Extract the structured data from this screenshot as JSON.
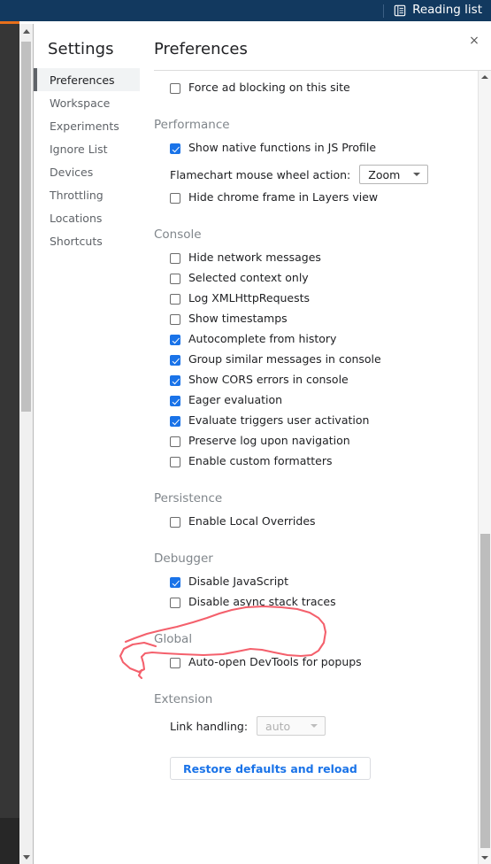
{
  "browser": {
    "reading_list_label": "Reading list",
    "reading_list_icon": "reading-list-icon",
    "topbar_color": "#12395f"
  },
  "dialog": {
    "close_label": "×",
    "sidebar_title": "Settings",
    "content_title": "Preferences"
  },
  "sidebar": {
    "items": [
      {
        "label": "Preferences",
        "selected": true
      },
      {
        "label": "Workspace",
        "selected": false
      },
      {
        "label": "Experiments",
        "selected": false
      },
      {
        "label": "Ignore List",
        "selected": false
      },
      {
        "label": "Devices",
        "selected": false
      },
      {
        "label": "Throttling",
        "selected": false
      },
      {
        "label": "Locations",
        "selected": false
      },
      {
        "label": "Shortcuts",
        "selected": false
      }
    ]
  },
  "preferences": {
    "orphan_setting": {
      "label": "Force ad blocking on this site",
      "checked": false
    },
    "sections": [
      {
        "title": "Performance",
        "rows": [
          {
            "kind": "checkbox",
            "label": "Show native functions in JS Profile",
            "checked": true
          },
          {
            "kind": "select",
            "label": "Flamechart mouse wheel action:",
            "value": "Zoom",
            "disabled": false
          },
          {
            "kind": "checkbox",
            "label": "Hide chrome frame in Layers view",
            "checked": false
          }
        ]
      },
      {
        "title": "Console",
        "rows": [
          {
            "kind": "checkbox",
            "label": "Hide network messages",
            "checked": false
          },
          {
            "kind": "checkbox",
            "label": "Selected context only",
            "checked": false
          },
          {
            "kind": "checkbox",
            "label": "Log XMLHttpRequests",
            "checked": false
          },
          {
            "kind": "checkbox",
            "label": "Show timestamps",
            "checked": false
          },
          {
            "kind": "checkbox",
            "label": "Autocomplete from history",
            "checked": true
          },
          {
            "kind": "checkbox",
            "label": "Group similar messages in console",
            "checked": true
          },
          {
            "kind": "checkbox",
            "label": "Show CORS errors in console",
            "checked": true
          },
          {
            "kind": "checkbox",
            "label": "Eager evaluation",
            "checked": true
          },
          {
            "kind": "checkbox",
            "label": "Evaluate triggers user activation",
            "checked": true
          },
          {
            "kind": "checkbox",
            "label": "Preserve log upon navigation",
            "checked": false
          },
          {
            "kind": "checkbox",
            "label": "Enable custom formatters",
            "checked": false
          }
        ]
      },
      {
        "title": "Persistence",
        "rows": [
          {
            "kind": "checkbox",
            "label": "Enable Local Overrides",
            "checked": false
          }
        ]
      },
      {
        "title": "Debugger",
        "rows": [
          {
            "kind": "checkbox",
            "label": "Disable JavaScript",
            "checked": true
          },
          {
            "kind": "checkbox",
            "label": "Disable async stack traces",
            "checked": false
          }
        ]
      },
      {
        "title": "Global",
        "rows": [
          {
            "kind": "checkbox",
            "label": "Auto-open DevTools for popups",
            "checked": false
          }
        ]
      },
      {
        "title": "Extension",
        "rows": [
          {
            "kind": "select",
            "label": "Link handling:",
            "value": "auto",
            "disabled": true
          }
        ]
      }
    ],
    "restore_button_label": "Restore defaults and reload"
  },
  "annotation": {
    "color": "#f4606c",
    "target_label": "Disable JavaScript",
    "shape": "hand-drawn-ellipse"
  }
}
